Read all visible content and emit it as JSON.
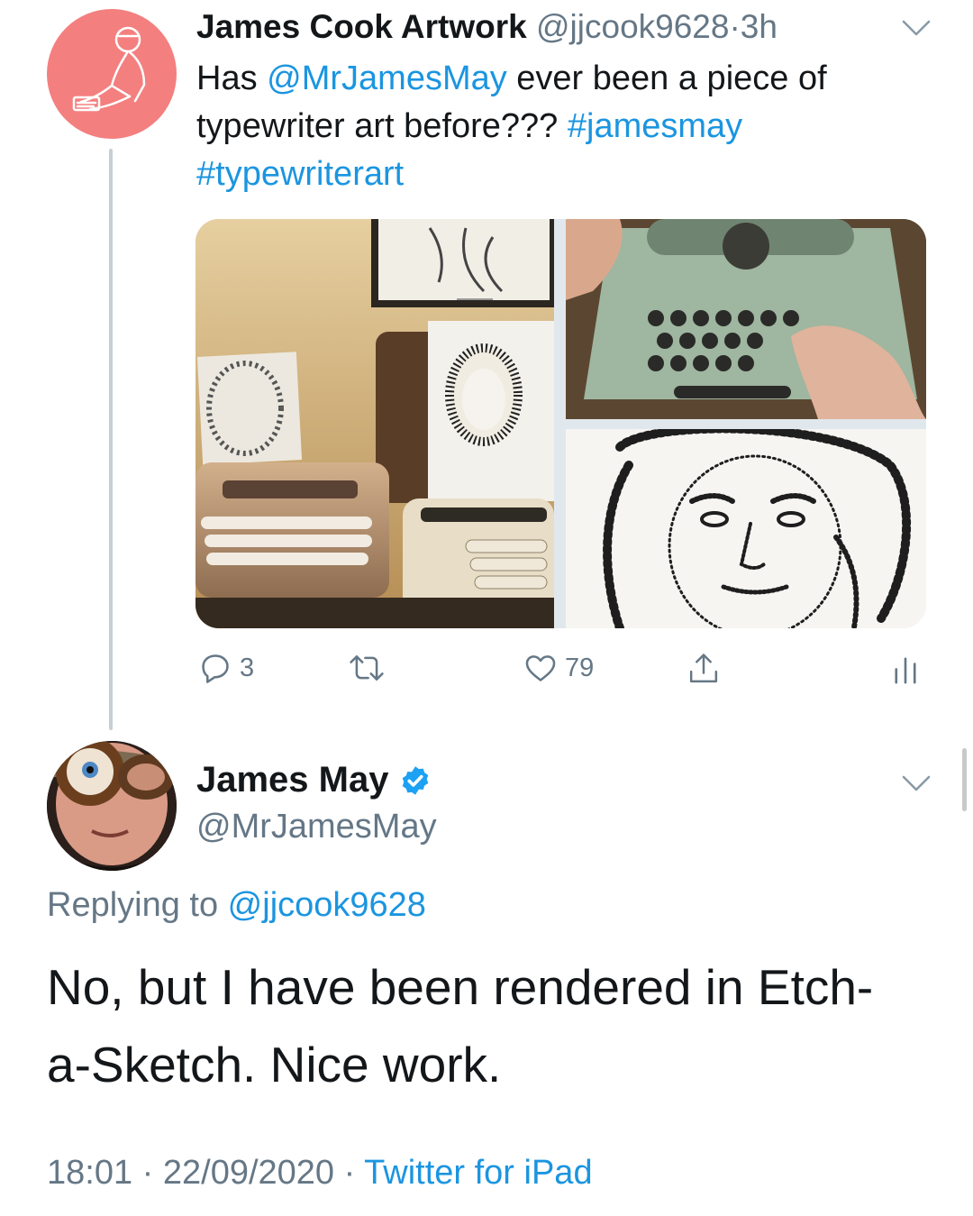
{
  "tweet1": {
    "display_name": "James Cook Artwork",
    "handle": "@jjcook9628",
    "separator": "·",
    "time_ago": "3h",
    "text_prefix": "Has ",
    "mention": "@MrJamesMay",
    "text_middle": " ever been a piece of typewriter art before??? ",
    "hashtag1": "#jamesmay",
    "hashtag2": "#typewriterart",
    "media": [
      {
        "icon": "typewriters-with-portraits-photo"
      },
      {
        "icon": "hands-typing-on-green-typewriter-photo"
      },
      {
        "icon": "typewriter-art-portrait-photo"
      }
    ],
    "actions": {
      "reply_count": "3",
      "like_count": "79"
    }
  },
  "tweet2": {
    "display_name": "James May",
    "handle": "@MrJamesMay",
    "replying_label": "Replying to ",
    "replying_to": "@jjcook9628",
    "text": "No, but I have been rendered in Etch-a-Sketch. Nice work.",
    "time": "18:01",
    "separator": "·",
    "date": "22/09/2020",
    "source": "Twitter for iPad"
  },
  "colors": {
    "link": "#1b95e0",
    "secondary_text": "#657786",
    "avatar1_bg": "#f47f7f",
    "thread_line": "#c4cfd6"
  }
}
